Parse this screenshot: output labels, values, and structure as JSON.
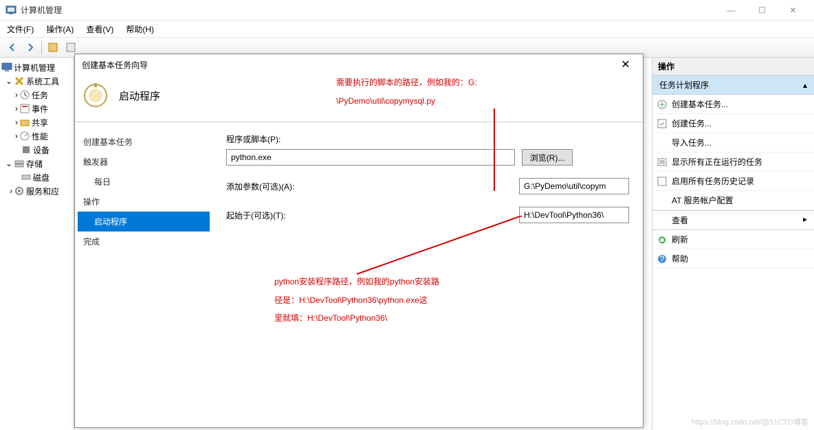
{
  "window": {
    "title": "计算机管理"
  },
  "win_controls": {
    "min": "—",
    "max": "☐",
    "close": "✕"
  },
  "menu": {
    "file": "文件(F)",
    "action": "操作(A)",
    "view": "查看(V)",
    "help": "帮助(H)"
  },
  "tree": {
    "root": "计算机管理",
    "sys_tools": "系统工具",
    "task": "任务",
    "event": "事件",
    "share": "共享",
    "perf": "性能",
    "device": "设备",
    "storage": "存储",
    "disk": "磁盘",
    "svc": "服务和应"
  },
  "actions": {
    "header": "操作",
    "selected": "任务计划程序",
    "create_basic": "创建基本任务...",
    "create": "创建任务...",
    "import": "导入任务...",
    "show_running": "显示所有正在运行的任务",
    "enable_history": "启用所有任务历史记录",
    "at_config": "AT 服务帐户配置",
    "view": "查看",
    "refresh": "刷新",
    "help": "帮助"
  },
  "dialog": {
    "title": "创建基本任务向导",
    "header": "启动程序",
    "steps": {
      "create": "创建基本任务",
      "trigger": "触发器",
      "daily": "每日",
      "action": "操作",
      "start_program": "启动程序",
      "finish": "完成"
    },
    "labels": {
      "program": "程序或脚本(P):",
      "args": "添加参数(可选)(A):",
      "start_in": "起始于(可选)(T):",
      "browse": "浏览(R)..."
    },
    "values": {
      "program": "python.exe",
      "args": "G:\\PyDemo\\util\\copym",
      "start_in": "H:\\DevTool\\Python36\\"
    }
  },
  "annotations": {
    "a1_l1": "需要执行的脚本的路径，例如我的：G:",
    "a1_l2": "\\PyDemo\\util\\copymysql.py",
    "a2_l1": "python安装程序路径，例如我的python安装路",
    "a2_l2": "径是：H:\\DevTool\\Python36\\python.exe这",
    "a2_l3": "里就填：H:\\DevTool\\Python36\\"
  },
  "watermark": "https://blog.csdn.net/@51CTO博客"
}
